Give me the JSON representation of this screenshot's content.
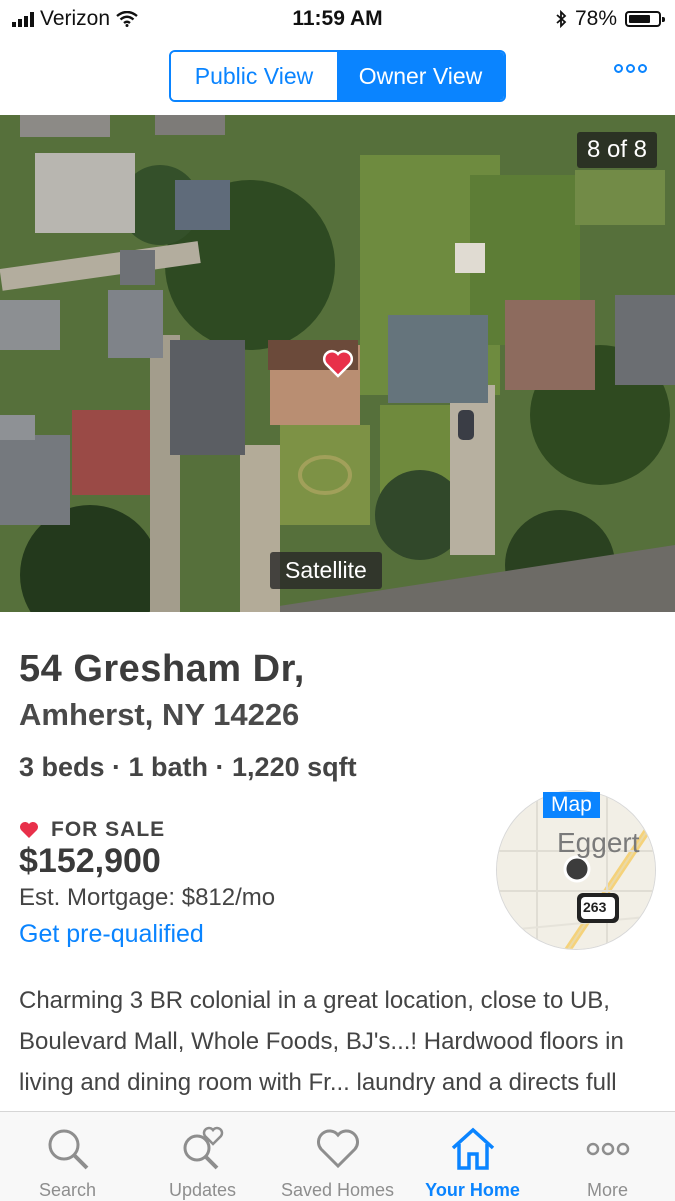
{
  "status_bar": {
    "carrier": "Verizon",
    "time": "11:59 AM",
    "battery": "78%",
    "battery_level": 0.78
  },
  "view_toggle": {
    "public_label": "Public View",
    "owner_label": "Owner View",
    "selected": "Owner View"
  },
  "photo": {
    "counter": "8 of 8",
    "satellite_label": "Satellite"
  },
  "listing": {
    "address_line1": "54 Gresham Dr,",
    "address_line2": "Amherst, NY 14226",
    "facts": "3 beds · 1 bath · 1,220 sqft",
    "status": "FOR SALE",
    "price": "$152,900",
    "mortgage": "Est. Mortgage: $812/mo",
    "prequal_link": "Get pre-qualified",
    "description": "Charming 3 BR colonial in a great location, close to UB, Boulevard Mall, Whole Foods, BJ's...! Hardwood floors in living and dining room with Fr... laundry and a directs full"
  },
  "map": {
    "label": "Map",
    "street": "Eggert",
    "route": "263"
  },
  "tabbar": {
    "items": [
      {
        "label": "Search",
        "icon": "search-icon"
      },
      {
        "label": "Updates",
        "icon": "updates-icon"
      },
      {
        "label": "Saved Homes",
        "icon": "heart-icon"
      },
      {
        "label": "Your Home",
        "icon": "home-icon"
      },
      {
        "label": "More",
        "icon": "more-icon"
      }
    ],
    "active": "Your Home"
  },
  "colors": {
    "accent": "#0a84ff",
    "heart": "#e8304a"
  }
}
